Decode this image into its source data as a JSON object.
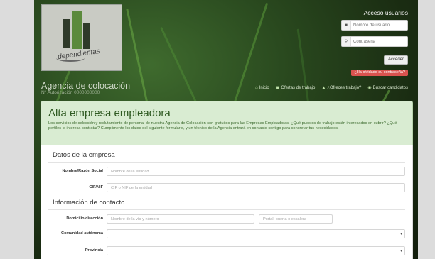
{
  "logo": {
    "text": "dependientas"
  },
  "agency": {
    "title": "Agencia de colocación",
    "subtitle": "Nº Autorización 0000000000"
  },
  "login": {
    "title": "Acceso usuarios",
    "user_placeholder": "Nombre de usuario",
    "password_placeholder": "Contraseña",
    "submit": "Acceder",
    "forgot": "¿Ha olvidado su contraseña?"
  },
  "nav": [
    {
      "label": "Inicio",
      "icon": "home-icon"
    },
    {
      "label": "Ofertas de trabajo",
      "icon": "briefcase-icon"
    },
    {
      "label": "¿Ofreces trabajo?",
      "icon": "user-icon"
    },
    {
      "label": "Buscar candidatos",
      "icon": "search-icon"
    }
  ],
  "banner": {
    "title": "Alta empresa empleadora",
    "text": "Los servicios de selección y reclutamiento de personal de nuestra Agencia de Colocación son gratuitos para las Empresas Empleadoras. ¿Qué puestos de trabajo están interesados en cubrir? ¿Qué perfiles le interesa contratar? Cumplimente los datos del siguiente formulario, y un técnico de la Agencia entrará en contacto contigo para concretar tus necesidades."
  },
  "form": {
    "company_section": "Datos de la empresa",
    "name_label": "Nombre/Razón Social",
    "name_placeholder": "Nombre de la entidad",
    "cif_label": "CIF/NIF",
    "cif_placeholder": "CIF o NIF de la entidad",
    "contact_section": "Información de contacto",
    "address_label": "Domicilio/dirección",
    "address_placeholder": "Nombre de la vía y número",
    "floor_placeholder": "Portal, puerta o escalera",
    "region_label": "Comunidad autónoma",
    "province_label": "Provincia"
  },
  "colors": {
    "accent_green": "#2f5a22",
    "danger": "#d9534f",
    "banner_bg": "#d9ecd2"
  }
}
